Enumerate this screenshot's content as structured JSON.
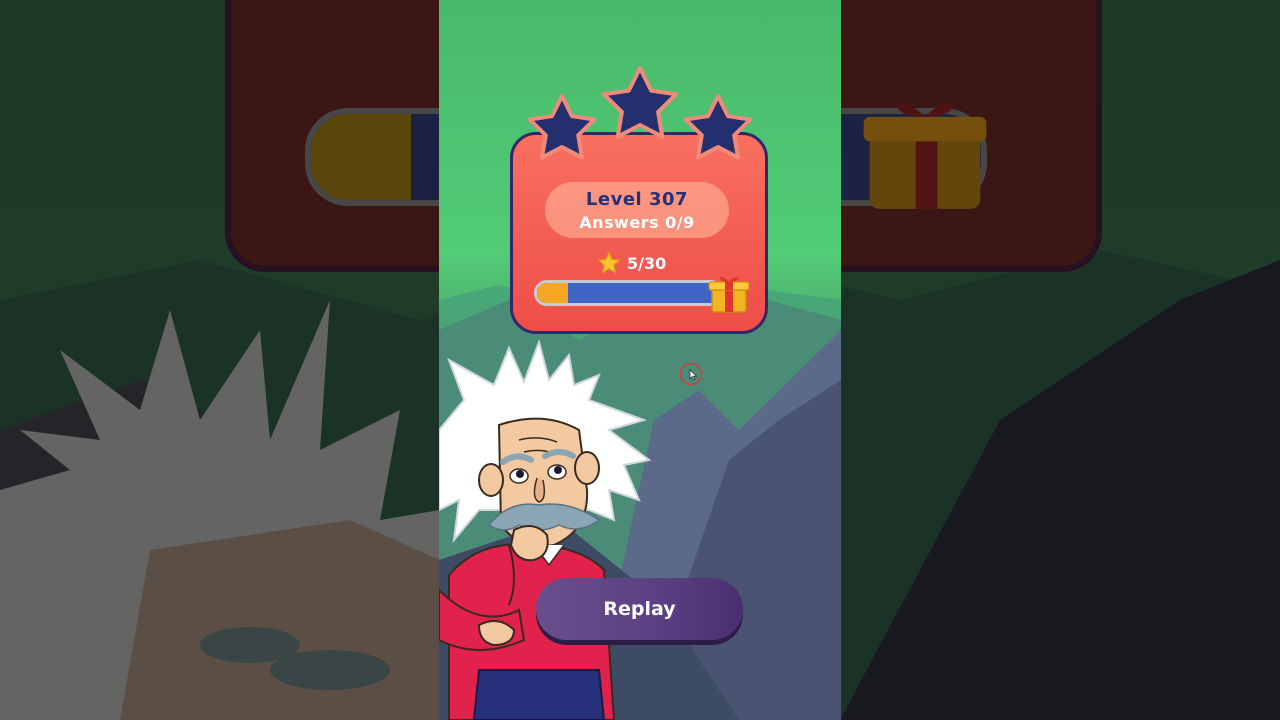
{
  "level": {
    "title": "Level 307",
    "answers": "Answers 0/9"
  },
  "stars": {
    "earned": 0,
    "total": 3
  },
  "star_progress": {
    "label": "5/30",
    "value": 5,
    "max": 30
  },
  "buttons": {
    "replay_label": "Replay"
  },
  "colors": {
    "card": "#ef4d48",
    "star_empty": "#232f6e",
    "progress_fill": "#f5a623",
    "progress_track": "#3f64c4",
    "button": "#5a3f82"
  },
  "icons": {
    "reward": "gift-icon",
    "star": "star-icon"
  }
}
